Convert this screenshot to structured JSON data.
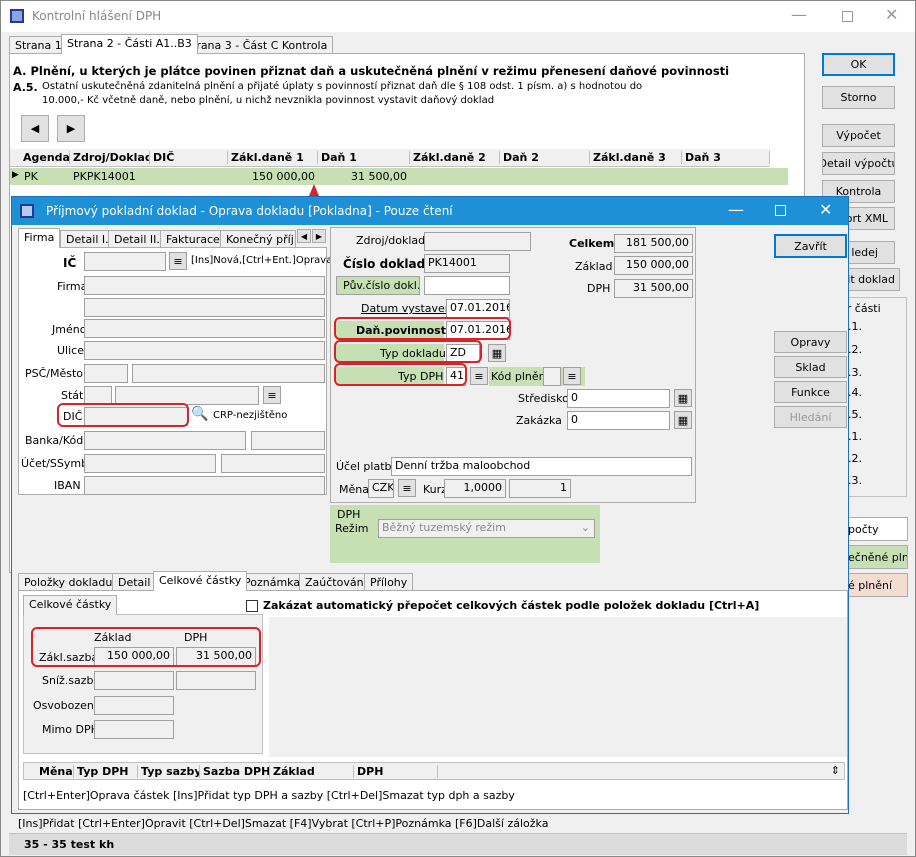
{
  "outer": {
    "title": "Kontrolní hlášení DPH",
    "tabs": [
      "Strana 1",
      "Strana 2 - Části A1..B3",
      "Strana 3 - Část C Kontrola"
    ],
    "section_a": "A. Plnění, u kterých je plátce povinen přiznat daň a uskutečněná plnění v režimu přenesení daňové povinnosti",
    "a5_code": "A.5.",
    "a5_line1": "Ostatní uskutečněná zdanitelná plnění a přijaté úplaty s povinností přiznat daň dle § 108 odst. 1 písm. a) s hodnotou do",
    "a5_line2": "10.000,- Kč včetně daně, nebo plnění, u nichž nevznikla povinnost vystavit daňový doklad",
    "grid_headers": [
      "Agenda",
      "Zdroj/Doklad",
      "DIČ",
      "Zákl.daně 1",
      "Daň 1",
      "Zákl.daně 2",
      "Daň 2",
      "Zákl.daně 3",
      "Daň 3"
    ],
    "grid_row": {
      "agenda": "PK",
      "doklad": "PKPK14001",
      "dic": "",
      "zaklad1": "150 000,00",
      "dan1": "31 500,00"
    },
    "buttons": {
      "ok": "OK",
      "storno": "Storno",
      "vypocet": "Výpočet",
      "detail": "Detail výpočtu",
      "kontrola": "Kontrola",
      "export": "ort XML",
      "hledej": "ledej",
      "zit": "zit doklad"
    },
    "side_list_title": "er části",
    "side_list": [
      ".1.",
      ".2.",
      ".3.",
      ".4.",
      ".5.",
      ".1.",
      ".2.",
      ".3."
    ],
    "side_buttons": [
      "počty",
      "ečněné pln.",
      "é plnění"
    ],
    "status_hint": "[Ins]Přidat  [Ctrl+Enter]Opravit  [Ctrl+Del]Smazat  [F4]Vybrat  [Ctrl+P]Poznámka  [F6]Další záložka",
    "status_bottom": "35 - 35 test kh"
  },
  "dialog": {
    "title": "Příjmový pokladní doklad - Oprava dokladu  [Pokladna] - Pouze čtení",
    "tabs": [
      "Firma",
      "Detail I.",
      "Detail II.",
      "Fakturace",
      "Konečný příj."
    ],
    "labels": {
      "ic": "IČ",
      "firma": "Firma",
      "jmeno": "Jméno",
      "ulice": "Ulice",
      "psc": "PSČ/Město",
      "stat": "Stát",
      "dic": "DIČ",
      "banka": "Banka/Kód",
      "ucet": "Účet/SSymb",
      "iban": "IBAN",
      "ic_hint": "[Ins]Nová,[Ctrl+Ent.]Oprava",
      "crp": "CRP-nezjištěno"
    },
    "doc": {
      "zdroj_label": "Zdroj/doklad",
      "cislo_label": "Číslo dokladu",
      "cislo": "PK14001",
      "puv_label": "Pův.číslo dokl.",
      "vystaveni_label": "Datum vystavení",
      "vystaveni": "07.01.2016",
      "povinnost_label": "Daň.povinnost",
      "povinnost": "07.01.2016",
      "typ_dokladu_label": "Typ dokladu",
      "typ_dokladu": "ZD",
      "typ_dph_label": "Typ DPH",
      "typ_dph": "41",
      "kod_plneni_label": "Kód plnění",
      "stredisko_label": "Středisko",
      "stredisko": "0",
      "zakazka_label": "Zakázka",
      "zakazka": "0",
      "ucel_label": "Účel platby",
      "ucel": "Denní tržba maloobchod",
      "mena_label": "Měna",
      "mena": "CZK",
      "kurz_label": "Kurz",
      "kurz": "1,0000",
      "kurz2": "1",
      "celkem_label": "Celkem",
      "celkem": "181 500,00",
      "zaklad_label": "Základ",
      "zaklad": "150 000,00",
      "dph_label": "DPH",
      "dph": "31 500,00",
      "dph_section": "DPH",
      "rezim_label": "Režim",
      "rezim": "Běžný tuzemský režim"
    },
    "buttons": {
      "zavrit": "Zavřít",
      "opravy": "Opravy",
      "sklad": "Sklad",
      "funkce": "Funkce",
      "hledani": "Hledání"
    },
    "lower_tabs": [
      "Položky dokladu",
      "Detail",
      "Celkové částky",
      "Poznámka",
      "Zaúčtování",
      "Přílohy"
    ],
    "celkove_tab": "Celkové částky",
    "checkbox_label": "Zakázat automatický přepočet celkových částek podle položek dokladu [Ctrl+A]",
    "sums": {
      "col_zaklad": "Základ",
      "col_dph": "DPH",
      "zakl_label": "Zákl.sazba",
      "zakl_zaklad": "150 000,00",
      "zakl_dph": "31 500,00",
      "sniz_label": "Sníž.sazba",
      "osv_label": "Osvobozeno",
      "mimo_label": "Mimo DPH"
    },
    "bottom_grid_headers": [
      "Měna",
      "Typ DPH",
      "Typ sazby",
      "Sazba DPH",
      "Základ",
      "DPH"
    ],
    "hint": "[Ctrl+Enter]Oprava částek  [Ins]Přidat typ DPH a sazby  [Ctrl+Del]Smazat typ dph a sazby"
  }
}
